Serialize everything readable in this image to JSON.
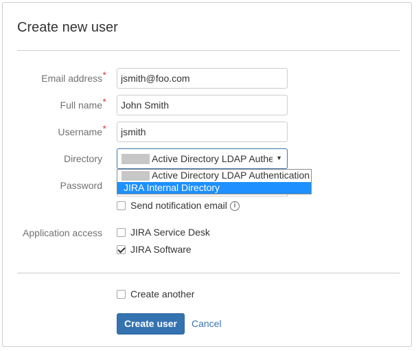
{
  "dialog": {
    "title": "Create new user"
  },
  "form": {
    "email": {
      "label": "Email address",
      "required_marker": "*",
      "value": "jsmith@foo.com"
    },
    "fullname": {
      "label": "Full name",
      "required_marker": "*",
      "value": "John Smith"
    },
    "username": {
      "label": "Username",
      "required_marker": "*",
      "value": "jsmith"
    },
    "directory": {
      "label": "Directory",
      "selected": "Active Directory LDAP Authentication",
      "options": [
        "Active Directory LDAP Authentication",
        "JIRA Internal Directory"
      ],
      "highlighted_option": "JIRA Internal Directory",
      "arrow_icon": "triangle-down"
    },
    "password": {
      "label": "Password"
    },
    "send_notification": {
      "label": "Send notification email",
      "checked": false,
      "icon": "info-icon"
    },
    "application_access": {
      "label": "Application access",
      "items": [
        {
          "label": "JIRA Service Desk",
          "checked": false
        },
        {
          "label": "JIRA Software",
          "checked": true
        }
      ]
    },
    "create_another": {
      "label": "Create another",
      "checked": false
    }
  },
  "actions": {
    "create_label": "Create user",
    "cancel_label": "Cancel"
  },
  "colors": {
    "primary": "#3572b0",
    "link": "#3b73af",
    "required": "#d04437",
    "highlight": "#1e90ff"
  }
}
